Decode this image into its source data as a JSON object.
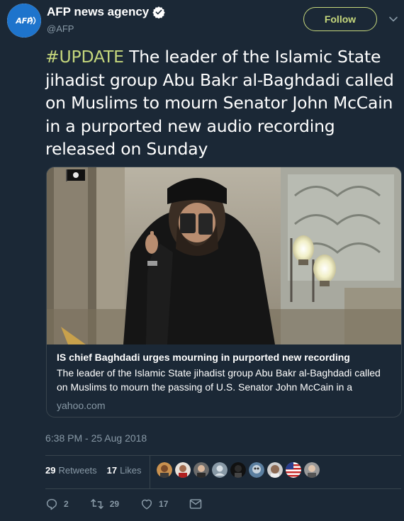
{
  "account": {
    "avatar_text": "AFP",
    "display_name": "AFP news agency",
    "handle": "@AFP",
    "verified": true
  },
  "follow_button": {
    "label": "Follow"
  },
  "tweet": {
    "hashtag": "#UPDATE",
    "text": " The leader of the Islamic State jihadist group Abu Bakr al-Baghdadi called on Muslims to mourn Senator John McCain in a purported new audio recording released on Sunday"
  },
  "card": {
    "title": "IS chief Baghdadi urges mourning in purported new recording",
    "description": "The leader of the Islamic State jihadist group Abu Bakr al-Baghdadi called on Muslims to mourn the passing of U.S. Senator John McCain in a",
    "domain": "yahoo.com"
  },
  "timestamp": "6:38 PM - 25 Aug 2018",
  "stats": {
    "retweets_count": "29",
    "retweets_label": "Retweets",
    "likes_count": "17",
    "likes_label": "Likes"
  },
  "actions": {
    "reply_count": "2",
    "retweet_count": "29",
    "like_count": "17"
  },
  "colors": {
    "background": "#1b2836",
    "accent": "#c5d77c",
    "muted_text": "#8899a6",
    "border": "#38444d"
  },
  "icons": [
    "verified-badge-icon",
    "chevron-down-icon",
    "reply-icon",
    "retweet-icon",
    "heart-icon",
    "direct-message-icon"
  ]
}
